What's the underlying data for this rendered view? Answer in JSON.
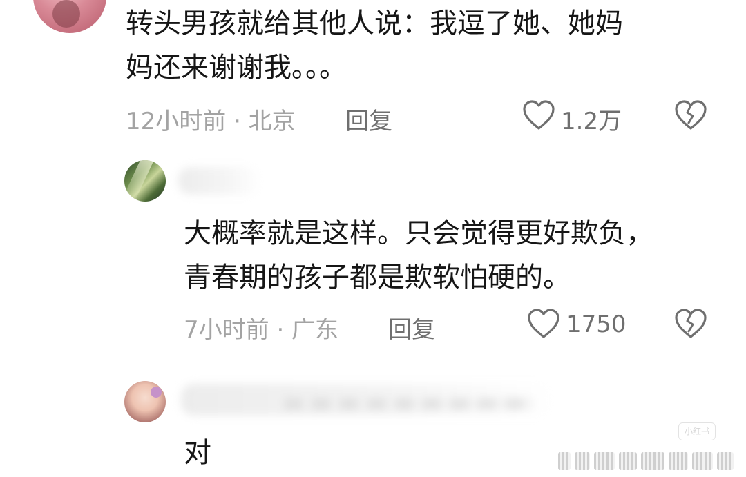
{
  "comments": [
    {
      "text": "转头男孩就给其他人说：我逗了她、她妈\n妈还来谢谢我。。。",
      "meta": "12小时前 · 北京",
      "reply_label": "回复",
      "likes": "1.2万"
    },
    {
      "text": "大概率就是这样。只会觉得更好欺负，\n青春期的孩子都是欺软怕硬的。",
      "meta": "7小时前 · 广东",
      "reply_label": "回复",
      "likes": "1750"
    },
    {
      "text": "对"
    }
  ],
  "watermark": "小红书",
  "icons": {
    "like": "heart-outline-icon",
    "dislike": "broken-heart-icon"
  },
  "colors": {
    "text": "#161616",
    "meta": "#a3a3a3",
    "action": "#6f6f6f",
    "background": "#ffffff"
  }
}
